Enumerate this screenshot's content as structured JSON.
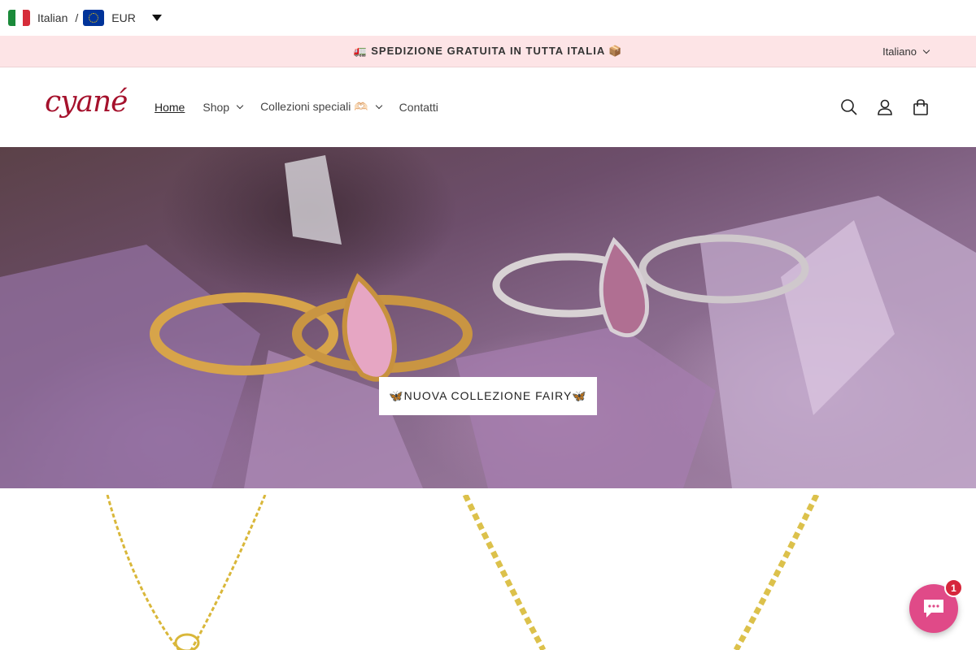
{
  "locale_bar": {
    "language": "Italian",
    "separator": "/",
    "currency": "EUR",
    "icons": [
      "italy-flag-icon",
      "eu-flag-icon",
      "caret-down-icon"
    ]
  },
  "announcement": {
    "text": "🚛 SPEDIZIONE GRATUITA IN TUTTA ITALIA 📦",
    "language_selector": "Italiano",
    "background": "#fde4e6"
  },
  "header": {
    "logo_text": "cyané",
    "brand_color": "#a5112c",
    "nav": [
      {
        "label": "Home",
        "active": true
      },
      {
        "label": "Shop",
        "has_dropdown": true
      },
      {
        "label": "Collezioni speciali 🫶🏻",
        "has_dropdown": true
      },
      {
        "label": "Contatti"
      }
    ],
    "icons": [
      "search-icon",
      "account-icon",
      "cart-icon"
    ]
  },
  "hero": {
    "cta_label": "🦋NUOVA COLLEZIONE FAIRY🦋"
  },
  "chat": {
    "badge_count": "1",
    "color": "#e04a88"
  }
}
